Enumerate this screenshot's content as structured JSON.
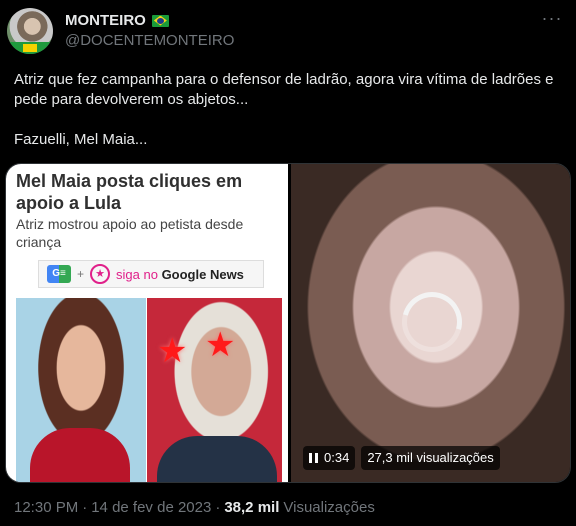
{
  "author": {
    "display_name": "MONTEIRO",
    "handle": "@DOCENTEMONTEIRO",
    "badge_icon": "brazil-flag-emoji"
  },
  "tweet": {
    "text_line1": "Atriz que fez campanha para o defensor de ladrão, agora vira vítima de ladrões e pede para devolverem os abjetos...",
    "text_line2": "Fazuelli, Mel Maia..."
  },
  "media": {
    "image": {
      "headline": "Mel Maia posta cliques em apoio a Lula",
      "subhead": "Atriz mostrou apoio ao petista desde criança",
      "gnews_logo_text": "G≡",
      "gnews_plus": "+",
      "gnews_star": "★",
      "gnews_follow": "siga no",
      "gnews_brand": "Google News"
    },
    "video": {
      "elapsed": "0:34",
      "views": "27,3 mil visualizações"
    }
  },
  "footer": {
    "time": "12:30 PM",
    "separator": "·",
    "date": "14 de fev de 2023",
    "separator2": "·",
    "views_count": "38,2 mil",
    "views_label": "Visualizações"
  },
  "colors": {
    "background": "#000000",
    "text_primary": "#e7e9ea",
    "text_secondary": "#71767b",
    "accent_pink": "#e0208a"
  }
}
